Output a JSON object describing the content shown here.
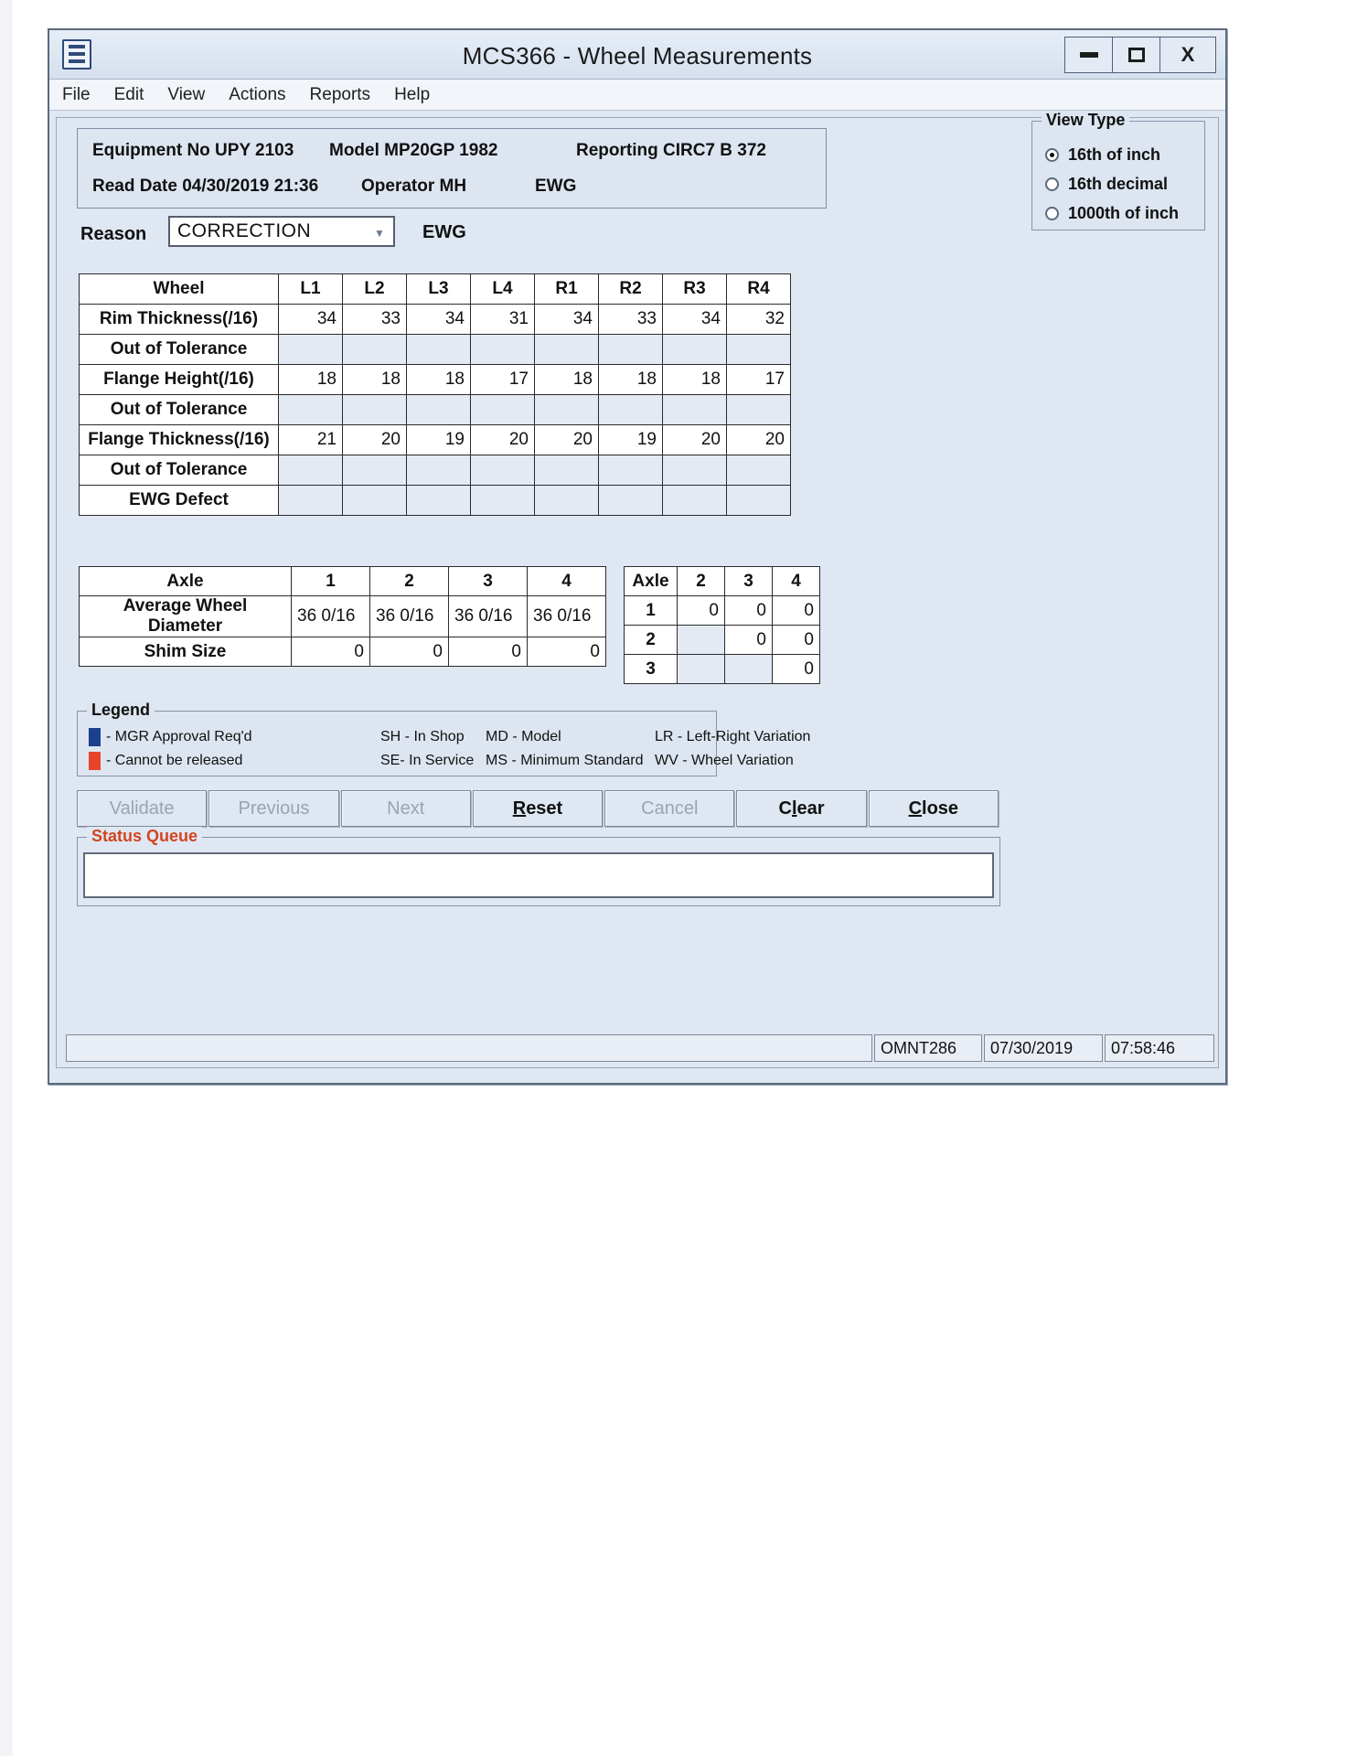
{
  "window": {
    "title": "MCS366 - Wheel Measurements",
    "icon": "application-icon",
    "controls": {
      "minimize": "–",
      "maximize": "□",
      "close": "X"
    }
  },
  "menu": {
    "items": [
      "File",
      "Edit",
      "View",
      "Actions",
      "Reports",
      "Help"
    ]
  },
  "header": {
    "equipment_label": "Equipment No UPY   2103",
    "model_label": "Model   MP20GP    1982",
    "reporting_label": "Reporting CIRC7   B 372",
    "read_date_label": "Read Date  04/30/2019 21:36",
    "operator_label": "Operator   MH",
    "ewg_label": "EWG"
  },
  "view_type": {
    "group_title": "View Type",
    "options": [
      {
        "label": "16th of inch",
        "selected": true
      },
      {
        "label": "16th decimal",
        "selected": false
      },
      {
        "label": "1000th of inch",
        "selected": false
      }
    ]
  },
  "reason": {
    "label": "Reason",
    "value": "CORRECTION",
    "arrow": "chevron-down-icon",
    "suffix": "EWG"
  },
  "wheel_table": {
    "columns": [
      "Wheel",
      "L1",
      "L2",
      "L3",
      "L4",
      "R1",
      "R2",
      "R3",
      "R4"
    ],
    "rows": [
      {
        "label": "Rim Thickness(/16)",
        "values": [
          "34",
          "33",
          "34",
          "31",
          "34",
          "33",
          "34",
          "32"
        ]
      },
      {
        "label": "Out of Tolerance",
        "values": [
          "",
          "",
          "",
          "",
          "",
          "",
          "",
          ""
        ]
      },
      {
        "label": "Flange Height(/16)",
        "values": [
          "18",
          "18",
          "18",
          "17",
          "18",
          "18",
          "18",
          "17"
        ]
      },
      {
        "label": "Out of Tolerance",
        "values": [
          "",
          "",
          "",
          "",
          "",
          "",
          "",
          ""
        ]
      },
      {
        "label": "Flange Thickness(/16)",
        "values": [
          "21",
          "20",
          "19",
          "20",
          "20",
          "19",
          "20",
          "20"
        ]
      },
      {
        "label": "Out of Tolerance",
        "values": [
          "",
          "",
          "",
          "",
          "",
          "",
          "",
          ""
        ]
      },
      {
        "label": "EWG Defect",
        "values": [
          "",
          "",
          "",
          "",
          "",
          "",
          "",
          ""
        ]
      }
    ]
  },
  "axle_table": {
    "columns": [
      "Axle",
      "1",
      "2",
      "3",
      "4"
    ],
    "rows": [
      {
        "label": "Average Wheel Diameter",
        "values": [
          "36  0/16",
          "36  0/16",
          "36  0/16",
          "36  0/16"
        ],
        "align": "left"
      },
      {
        "label": "Shim Size",
        "values": [
          "0",
          "0",
          "0",
          "0"
        ],
        "align": "right"
      }
    ]
  },
  "variation_table": {
    "columns": [
      "Axle",
      "2",
      "3",
      "4"
    ],
    "rows": [
      {
        "label": "1",
        "values": [
          "0",
          "0",
          "0"
        ]
      },
      {
        "label": "2",
        "values": [
          "",
          "0",
          "0"
        ]
      },
      {
        "label": "3",
        "values": [
          "",
          "",
          "0"
        ]
      }
    ]
  },
  "legend": {
    "group_title": "Legend",
    "row1": {
      "swatch_color": "#1b3f8f",
      "swatch_text": "- MGR Approval Req'd",
      "col2": "SH - In Shop",
      "col3": "MD - Model",
      "col4": "LR - Left-Right Variation"
    },
    "row2": {
      "swatch_color": "#e8442a",
      "swatch_text": "- Cannot be released",
      "col2": "SE- In Service",
      "col3": "MS - Minimum Standard",
      "col4": "WV - Wheel Variation"
    }
  },
  "buttons": [
    {
      "label": "Validate",
      "disabled": true,
      "mnemonic": ""
    },
    {
      "label": "Previous",
      "disabled": true,
      "mnemonic": ""
    },
    {
      "label": "Next",
      "disabled": true,
      "mnemonic": ""
    },
    {
      "label": "Reset",
      "disabled": false,
      "mnemonic": "R"
    },
    {
      "label": "Cancel",
      "disabled": true,
      "mnemonic": ""
    },
    {
      "label": "Clear",
      "disabled": false,
      "mnemonic": "l"
    },
    {
      "label": "Close",
      "disabled": false,
      "mnemonic": "C"
    }
  ],
  "status_queue": {
    "group_title": "Status Queue",
    "value": "",
    "accent_color": "#d2451e"
  },
  "status_bar": {
    "message": "",
    "terminal": "OMNT286",
    "date": "07/30/2019",
    "time": "07:58:46"
  }
}
